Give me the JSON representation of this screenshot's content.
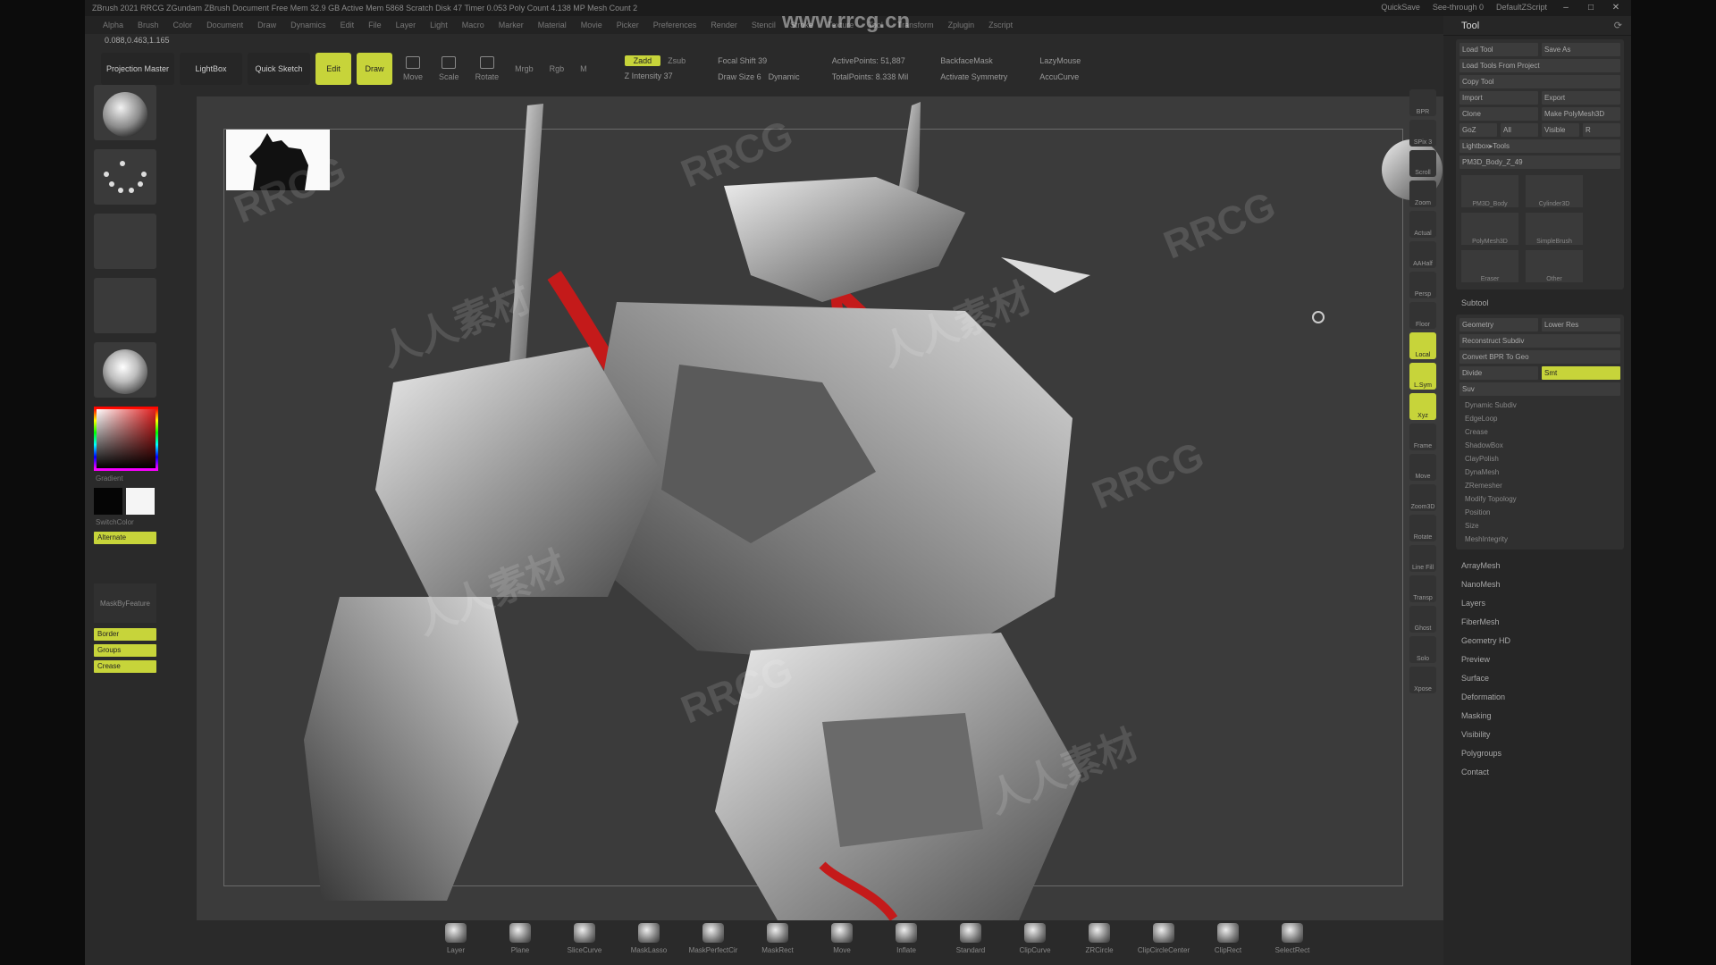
{
  "titlebar": {
    "text": "ZBrush 2021 RRCG ZGundam ZBrush Document  Free Mem 32.9 GB  Active Mem 5868  Scratch Disk 47  Timer 0.053  Poly Count 4.138 MP  Mesh Count 2",
    "quicksave": "QuickSave",
    "seethrough": "See-through  0",
    "default_zscript": "DefaultZScript"
  },
  "menubar": [
    "Alpha",
    "Brush",
    "Color",
    "Document",
    "Draw",
    "Dynamics",
    "Edit",
    "File",
    "Layer",
    "Light",
    "Macro",
    "Marker",
    "Material",
    "Movie",
    "Picker",
    "Preferences",
    "Render",
    "Stencil",
    "Stroke",
    "Texture",
    "Tool",
    "Transform",
    "Zplugin",
    "Zscript"
  ],
  "coords": "0.088,0.463,1.165",
  "toolbar": {
    "projection_master": "Projection Master",
    "lightbox": "LightBox",
    "quick_sketch": "Quick Sketch",
    "edit": "Edit",
    "draw": "Draw",
    "move": "Move",
    "scale": "Scale",
    "rotate": "Rotate",
    "mrgb": "Mrgb",
    "rgb": "Rgb",
    "m": "M",
    "zadd": "Zadd",
    "zsub": "Zsub",
    "z_intensity": "Z Intensity 37",
    "focal_shift": "Focal Shift 39",
    "draw_size": "Draw Size 6",
    "dynamic": "Dynamic",
    "active_points": "ActivePoints: 51,887",
    "total_points": "TotalPoints: 8.338 Mil",
    "backface_mask": "BackfaceMask",
    "activate_symmetry": "Activate Symmetry",
    "lazymouse": "LazyMouse",
    "accu_curve": "AccuCurve"
  },
  "left_tray": {
    "gradient_label": "Gradient",
    "switch_color_label": "SwitchColor",
    "alternate": "Alternate",
    "mask_by_feature": "MaskByFeature",
    "border": "Border",
    "groups": "Groups",
    "crease": "Crease"
  },
  "site_watermark": "www.rrcg.cn",
  "watermarks": [
    "RRCG",
    "人人素材",
    "RRCG",
    "人人素材",
    "RRCG",
    "人人素材",
    "RRCG",
    "人人素材",
    "RRCG"
  ],
  "right_tools": [
    "BPR",
    "SPix 3",
    "Scroll",
    "Zoom",
    "Actual",
    "AAHalf",
    "Persp",
    "Floor",
    "Local",
    "L.Sym",
    "Xyz",
    "Frame",
    "Move",
    "Zoom3D",
    "Rotate",
    "Line Fill",
    "Transp",
    "Ghost",
    "Solo",
    "Xpose"
  ],
  "tool_panel": {
    "title": "Tool",
    "load_tool": "Load Tool",
    "save_as": "Save As",
    "load_tools_from_project": "Load Tools From Project",
    "copy_tool": "Copy Tool",
    "import": "Import",
    "export": "Export",
    "clone": "Clone",
    "make_polymesh3d": "Make PolyMesh3D",
    "goz": "GoZ",
    "all": "All",
    "visible": "Visible",
    "r": "R",
    "lightbox_tools": "Lightbox▸Tools",
    "poly_count_label": "PM3D_Body_Z_49",
    "tools": [
      "PM3D_Body",
      "Cylinder3D",
      "PolyMesh3D",
      "SimpleBrush",
      "Eraser",
      "Other"
    ],
    "subtool": "Subtool",
    "geometry": "Geometry",
    "lower_res": "Lower Res",
    "reconstruct_subdiv": "Reconstruct Subdiv",
    "convert_bpr_to_geo": "Convert BPR To Geo",
    "divide": "Divide",
    "smt": "Smt",
    "suv": "Suv",
    "dynamic_subdiv": "Dynamic Subdiv",
    "edge_loop": "EdgeLoop",
    "crease": "Crease",
    "shadow_box": "ShadowBox",
    "clay_polish": "ClayPolish",
    "dynamesh": "DynaMesh",
    "zremesher": "ZRemesher",
    "modify_topology": "Modify Topology",
    "position": "Position",
    "size": "Size",
    "mesh_integrity": "MeshIntegrity",
    "list": [
      "ArrayMesh",
      "NanoMesh",
      "Layers",
      "FiberMesh",
      "Geometry HD",
      "Preview",
      "Surface",
      "Deformation",
      "Masking",
      "Visibility",
      "Polygroups",
      "Contact"
    ]
  },
  "shelf": [
    "Layer",
    "Plane",
    "SliceCurve",
    "MaskLasso",
    "MaskPerfectCir",
    "MaskRect",
    "Move",
    "Inflate",
    "Standard",
    "ClipCurve",
    "ZRCircle",
    "ClipCircleCenter",
    "ClipRect",
    "SelectRect"
  ],
  "colors": {
    "accent": "#c7d43a",
    "panel": "#262626",
    "canvas": "#3b3b3b",
    "model_red": "#c41a1a"
  }
}
